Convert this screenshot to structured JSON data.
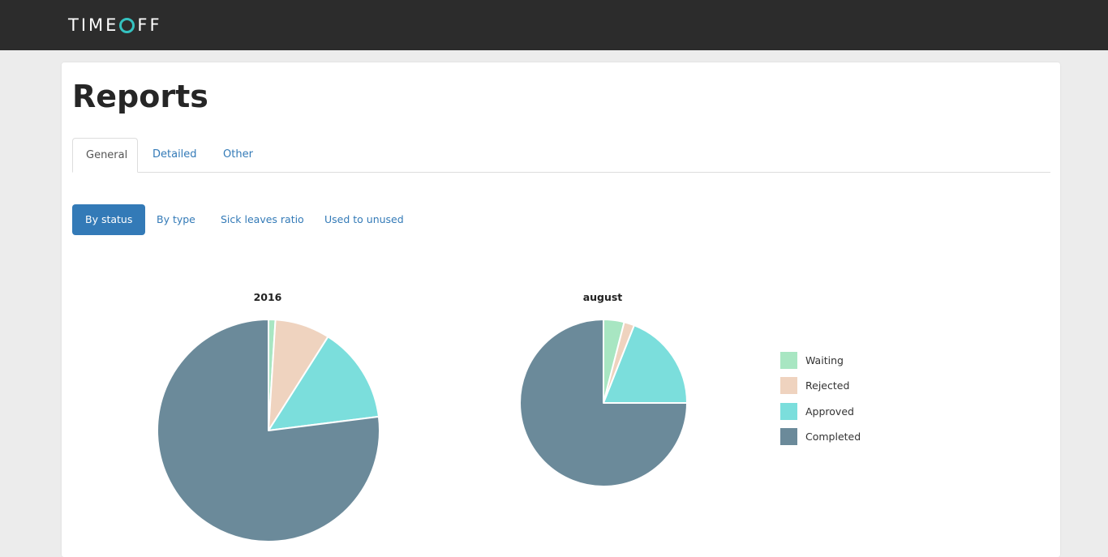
{
  "app": {
    "logo_text_left": "TIME",
    "logo_text_right": "FF"
  },
  "page": {
    "title": "Reports"
  },
  "tabs": [
    {
      "label": "General",
      "active": true
    },
    {
      "label": "Detailed",
      "active": false
    },
    {
      "label": "Other",
      "active": false
    }
  ],
  "subnav": [
    {
      "label": "By status",
      "active": true
    },
    {
      "label": "By type",
      "active": false
    },
    {
      "label": "Sick leaves ratio",
      "active": false
    },
    {
      "label": "Used to unused",
      "active": false
    }
  ],
  "colors": {
    "topbar": "#2c2c2c",
    "logo_accent": "#35c2c0",
    "primary": "#337ab7"
  },
  "chart_data": [
    {
      "type": "pie",
      "title": "2016",
      "categories": [
        "Waiting",
        "Rejected",
        "Approved",
        "Completed"
      ],
      "values": [
        1,
        8,
        14,
        77
      ],
      "colors": [
        "#a8e6c2",
        "#efd3bf",
        "#7bdedc",
        "#6b8a9a"
      ]
    },
    {
      "type": "pie",
      "title": "august",
      "categories": [
        "Waiting",
        "Rejected",
        "Approved",
        "Completed"
      ],
      "values": [
        4,
        2,
        19,
        75
      ],
      "colors": [
        "#a8e6c2",
        "#efd3bf",
        "#7bdedc",
        "#6b8a9a"
      ]
    }
  ],
  "legend": {
    "position": "right",
    "items": [
      {
        "label": "Waiting",
        "color": "#a8e6c2"
      },
      {
        "label": "Rejected",
        "color": "#efd3bf"
      },
      {
        "label": "Approved",
        "color": "#7bdedc"
      },
      {
        "label": "Completed",
        "color": "#6b8a9a"
      }
    ]
  }
}
